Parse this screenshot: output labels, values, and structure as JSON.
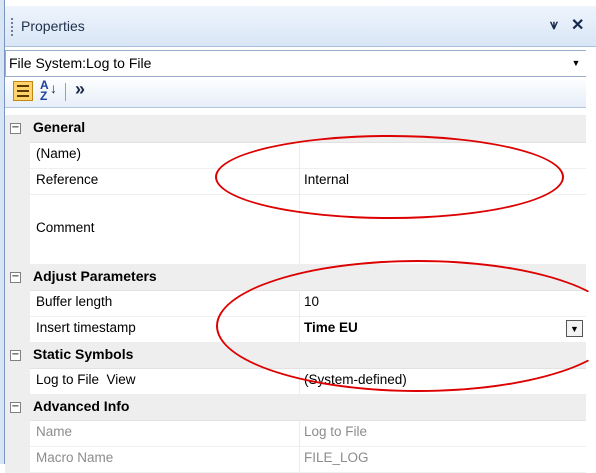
{
  "panel": {
    "title": "Properties",
    "pin_glyph": "p",
    "close_glyph": "×",
    "colors": {
      "header": "#dbe7f6",
      "category_bg": "#eeeeee",
      "annotation": "#dd0000"
    }
  },
  "object_selector": {
    "value": "File System:Log to File"
  },
  "toolbar": {
    "categorized_icon": "categorized-icon",
    "alphabetical_icon": "sort-az-icon",
    "more_glyph": "»"
  },
  "grid": {
    "categories": [
      {
        "name": "General",
        "properties": [
          {
            "name": "(Name)",
            "value": ""
          },
          {
            "name": "Reference",
            "value": "Internal"
          },
          {
            "name": "Comment",
            "value": ""
          }
        ]
      },
      {
        "name": "Adjust Parameters",
        "properties": [
          {
            "name": "Buffer length",
            "value": "10"
          },
          {
            "name": "Insert timestamp",
            "value": "Time EU"
          }
        ]
      },
      {
        "name": "Static Symbols",
        "properties": [
          {
            "name": "Log to File  View",
            "value": "(System-defined)"
          }
        ]
      },
      {
        "name": "Advanced Info",
        "properties": [
          {
            "name": "Name",
            "value": "Log to File"
          },
          {
            "name": "Macro Name",
            "value": "FILE_LOG"
          }
        ]
      }
    ],
    "expander_glyph": "−"
  }
}
